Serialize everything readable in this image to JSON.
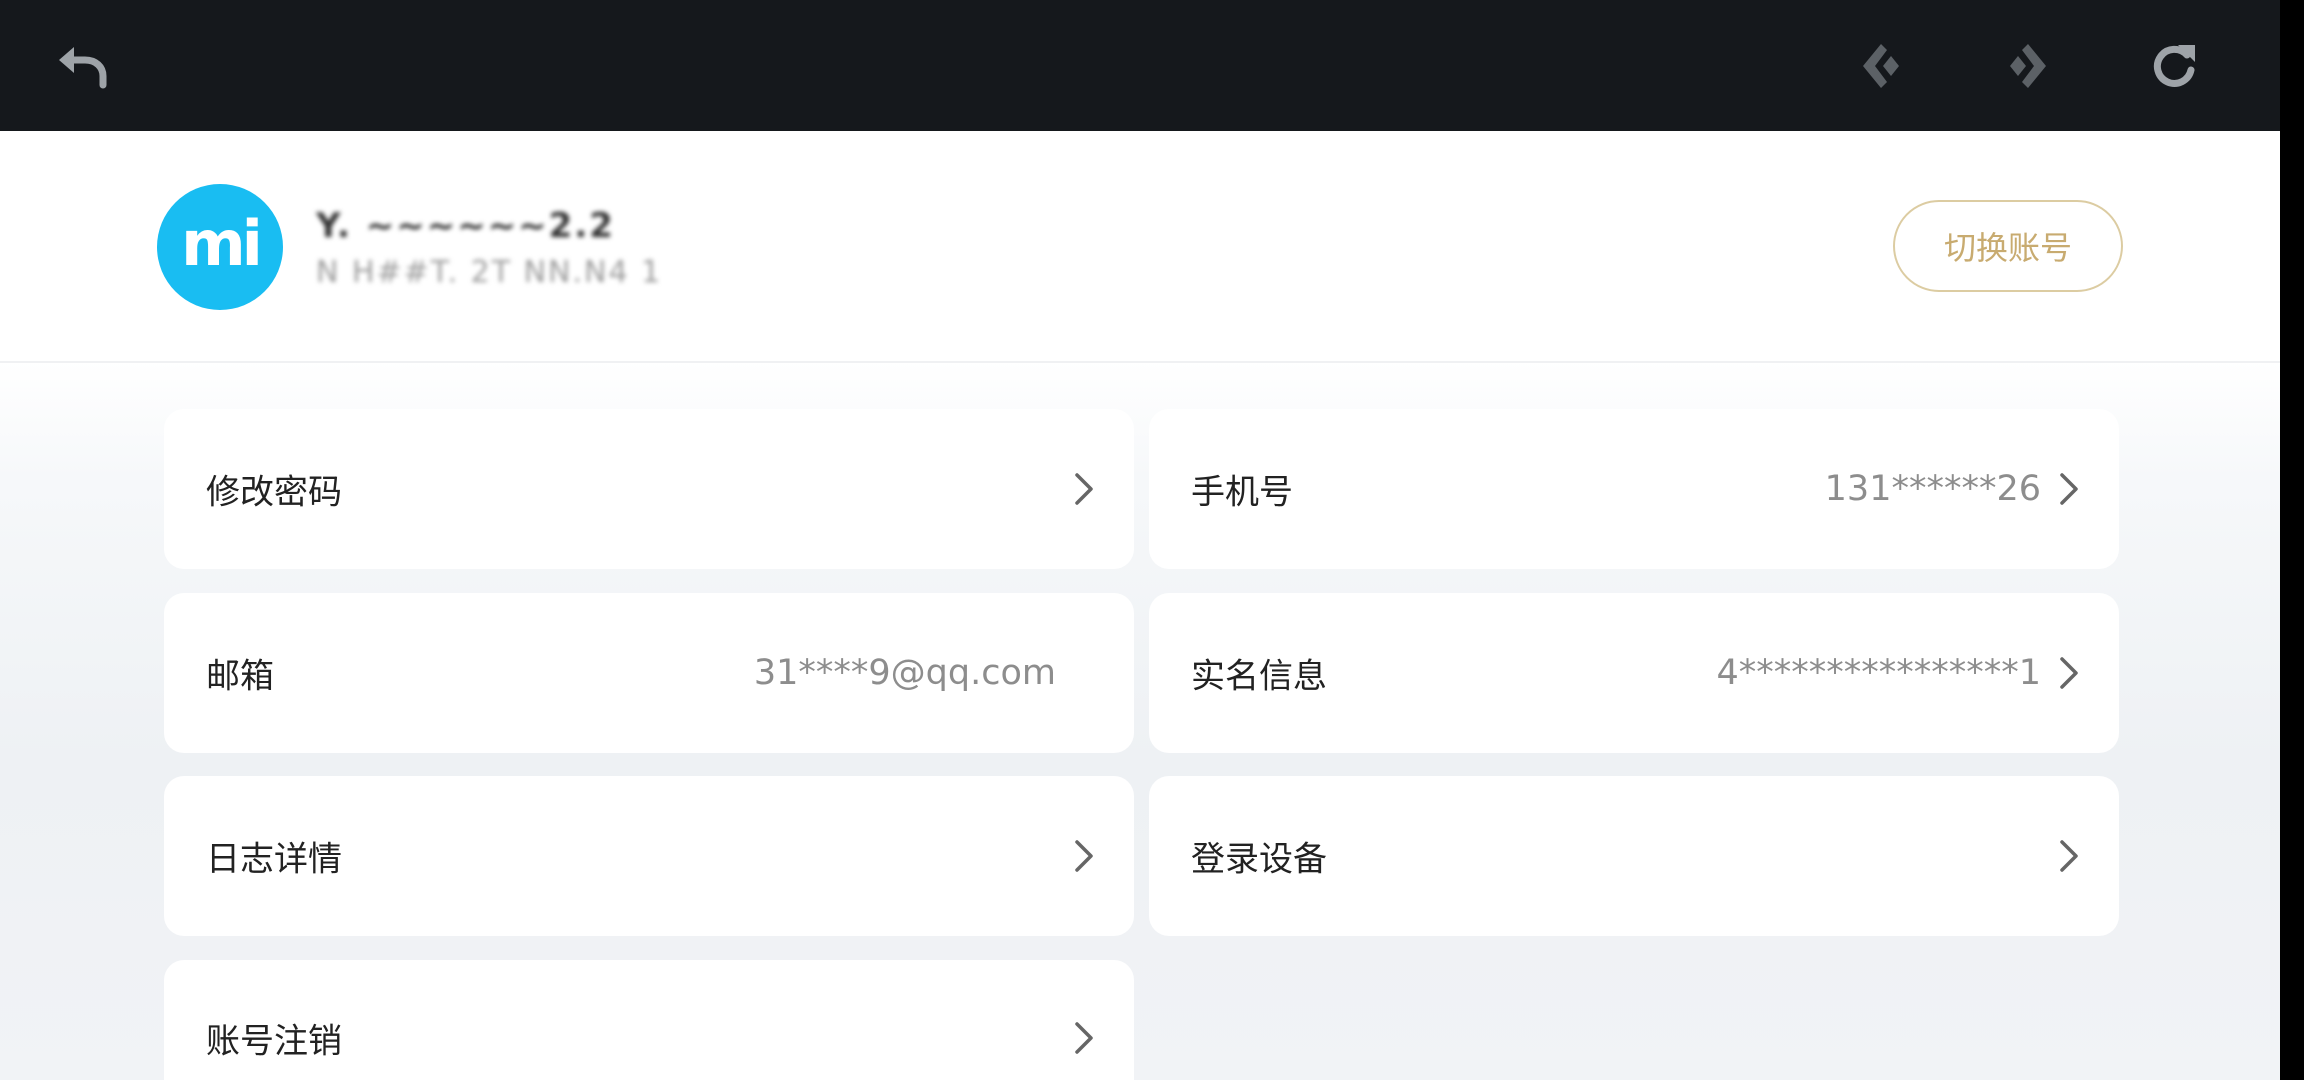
{
  "toolbar": {
    "back_icon": "back-arrow-icon",
    "prev_icon": "prev-arrow-icon",
    "next_icon": "next-arrow-icon",
    "refresh_icon": "refresh-icon",
    "background": "#15181c",
    "icon_color": "#9ea3a8"
  },
  "profile": {
    "avatar_text": "mi",
    "avatar_color": "#19bdf2",
    "name_blurred": "Y.  ~~~~~~2.2",
    "sub_blurred": "N  H##T.  2T NN.N4 1",
    "switch_account_label": "切换账号",
    "accent_color": "#c8ab70"
  },
  "settings": {
    "change_password": {
      "label": "修改密码"
    },
    "phone": {
      "label": "手机号",
      "value": "131******26"
    },
    "email": {
      "label": "邮箱",
      "value": "31****9@qq.com"
    },
    "real_name": {
      "label": "实名信息",
      "value": "4****************1"
    },
    "log_details": {
      "label": "日志详情"
    },
    "login_devices": {
      "label": "登录设备"
    },
    "deactivate_account": {
      "label": "账号注销"
    }
  }
}
